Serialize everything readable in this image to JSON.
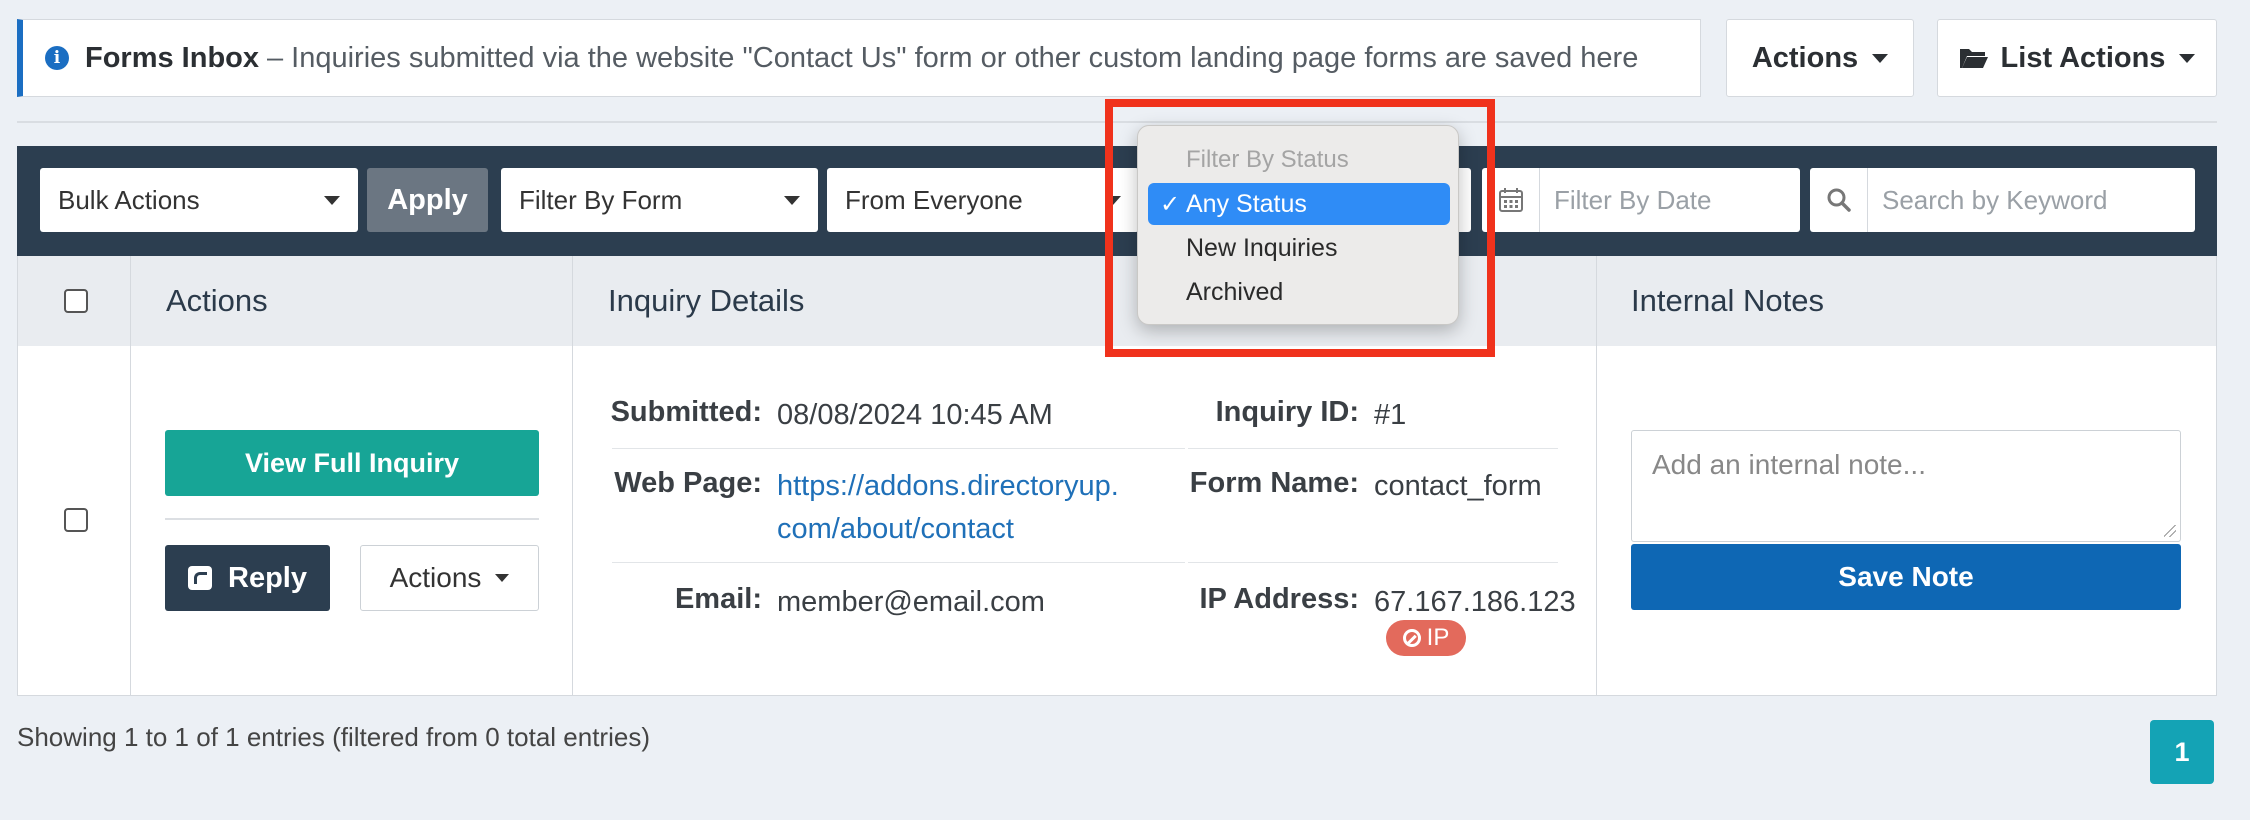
{
  "header": {
    "info_title": "Forms Inbox",
    "info_separator": "–",
    "info_description": "Inquiries submitted via the website \"Contact Us\" form or other custom landing page forms are saved here",
    "actions_label": "Actions",
    "list_actions_label": "List Actions"
  },
  "filters": {
    "bulk_actions": "Bulk Actions",
    "apply": "Apply",
    "filter_by_form": "Filter By Form",
    "from_everyone": "From Everyone",
    "filter_by_date_placeholder": "Filter By Date",
    "search_placeholder": "Search by Keyword"
  },
  "status_dropdown": {
    "header": "Filter By Status",
    "options": [
      {
        "label": "Any Status",
        "selected": true,
        "check": "✓"
      },
      {
        "label": "New Inquiries",
        "selected": false
      },
      {
        "label": "Archived",
        "selected": false
      }
    ]
  },
  "table": {
    "columns": {
      "actions": "Actions",
      "inquiry_details": "Inquiry Details",
      "internal_notes": "Internal Notes"
    },
    "row": {
      "view_full_inquiry": "View Full Inquiry",
      "reply": "Reply",
      "actions": "Actions",
      "submitted_label": "Submitted:",
      "submitted_value": "08/08/2024 10:45 AM",
      "web_page_label": "Web Page:",
      "web_page_line1": "https://addons.directoryup.",
      "web_page_line2": "com/about/contact",
      "email_label": "Email:",
      "email_value": "member@email.com",
      "inquiry_id_label": "Inquiry ID:",
      "inquiry_id_value": "#1",
      "form_name_label": "Form Name:",
      "form_name_value": "contact_form",
      "ip_address_label": "IP Address:",
      "ip_address_value": "67.167.186.123",
      "ip_badge": "IP",
      "note_placeholder": "Add an internal note...",
      "save_note": "Save Note"
    }
  },
  "footer": {
    "showing": "Showing 1 to 1 of 1 entries (filtered from 0 total entries)",
    "page": "1"
  },
  "colors": {
    "navy": "#2c3e50",
    "teal": "#17a596",
    "primary_blue": "#0e67b4",
    "highlight_red": "#f0321c",
    "selected_blue": "#2f8cf6"
  },
  "icons": [
    "info-icon",
    "caret-down-icon",
    "folder-open-icon",
    "calendar-icon",
    "search-icon",
    "reply-icon",
    "ban-icon",
    "checkmark-icon"
  ]
}
